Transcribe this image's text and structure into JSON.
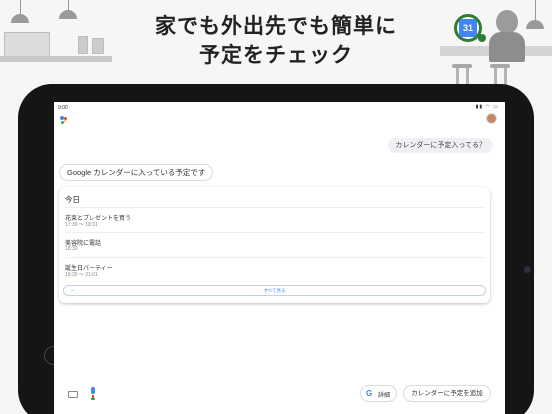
{
  "promo": {
    "headline_line1": "家でも外出先でも簡単に",
    "headline_line2": "予定をチェック",
    "calendar_badge": "31"
  },
  "status_bar": {
    "time": "9:00",
    "icons": "▮▮ ◠ ▭"
  },
  "conversation": {
    "user_query": "カレンダーに予定入ってる？",
    "assistant_reply": "Google カレンダーに入っている予定です"
  },
  "agenda": {
    "heading": "今日",
    "events": [
      {
        "title": "花束とプレゼントを買う",
        "time": "17:30 ～ 18:31"
      },
      {
        "title": "美容院に電話",
        "time": "18:30"
      },
      {
        "title": "誕生日パーティー",
        "time": "19:30 ～ 21:01"
      }
    ],
    "see_all_label": "すべて見る",
    "see_all_arrow": "→"
  },
  "bottom_bar": {
    "details_label": "詳細",
    "add_event_label": "カレンダーに予定を追加",
    "g_logo": "G"
  },
  "colors": {
    "accent_blue": "#4285f4",
    "badge_green": "#2e7d32"
  }
}
